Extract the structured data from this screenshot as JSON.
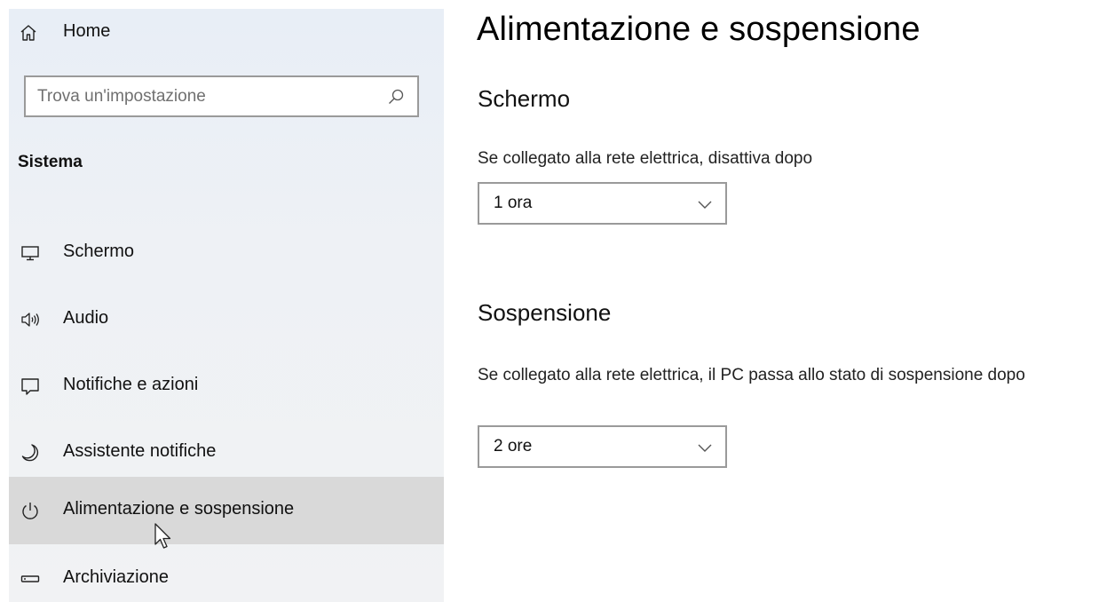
{
  "sidebar": {
    "home": {
      "label": "Home",
      "icon": "home-icon"
    },
    "search": {
      "placeholder": "Trova un'impostazione",
      "value": "",
      "icon": "search-icon"
    },
    "section_title": "Sistema",
    "items": [
      {
        "label": "Schermo",
        "icon": "monitor-icon",
        "selected": false
      },
      {
        "label": "Audio",
        "icon": "speaker-icon",
        "selected": false
      },
      {
        "label": "Notifiche e azioni",
        "icon": "notification-icon",
        "selected": false
      },
      {
        "label": "Assistente notifiche",
        "icon": "moon-icon",
        "selected": false
      },
      {
        "label": "Alimentazione e sospensione",
        "icon": "power-icon",
        "selected": true
      },
      {
        "label": "Archiviazione",
        "icon": "storage-icon",
        "selected": false
      }
    ],
    "selected_bg": "#d9d9d9"
  },
  "main": {
    "title": "Alimentazione e sospensione",
    "screen": {
      "heading": "Schermo",
      "description": "Se collegato alla rete elettrica, disattiva dopo",
      "selected": "1 ora"
    },
    "sleep": {
      "heading": "Sospensione",
      "description": "Se collegato alla rete elettrica, il PC passa allo stato di sospensione dopo",
      "selected": "2 ore"
    }
  }
}
